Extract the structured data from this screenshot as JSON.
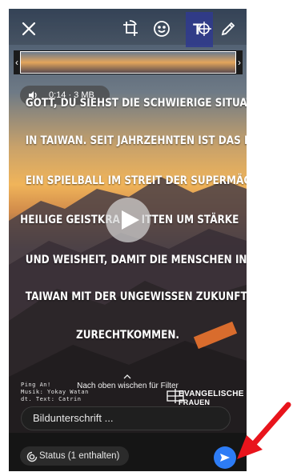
{
  "media": {
    "audio_duration": "0:14 · 3 MB"
  },
  "video_text": {
    "lines": [
      "GOTT, DU SIEHST DIE SCHWIERIGE SITUATION",
      "IN TAIWAN. SEIT JAHRZEHNTEN IST DAS LAND",
      "EIN SPIELBALL IM STREIT DER SUPERMÄCHTE.",
      "HEILIGE GEISTKRA",
      "ITTEN UM STÄRKE",
      "UND WEISHEIT, DAMIT DIE MENSCHEN IN",
      "TAIWAN MIT DER UNGEWISSEN ZUKUNFT",
      "ZURECHTKOMMEN."
    ],
    "credits": [
      "Ping An!",
      "Musik: Yokay Watan",
      "dt. Text: Catrin"
    ],
    "brand_line1": "EVANGELISCHE",
    "brand_line2": "FRAUEN"
  },
  "hints": {
    "swipe_up": "Nach oben wischen für Filter"
  },
  "composer": {
    "caption_placeholder": "Bildunterschrift ...",
    "status_label": "Status (1 enthalten)"
  },
  "icons": {
    "close": "close-icon",
    "crop_rotate": "crop-rotate-icon",
    "emoji": "emoji-icon",
    "text": "text-icon",
    "pencil": "pencil-icon",
    "speaker": "speaker-icon",
    "play": "play-icon",
    "status": "status-icon",
    "send": "send-icon"
  },
  "colors": {
    "send_button": "#2d7cf6",
    "annotation_arrow": "#e8141c",
    "sticker_orange": "#e8722e"
  }
}
